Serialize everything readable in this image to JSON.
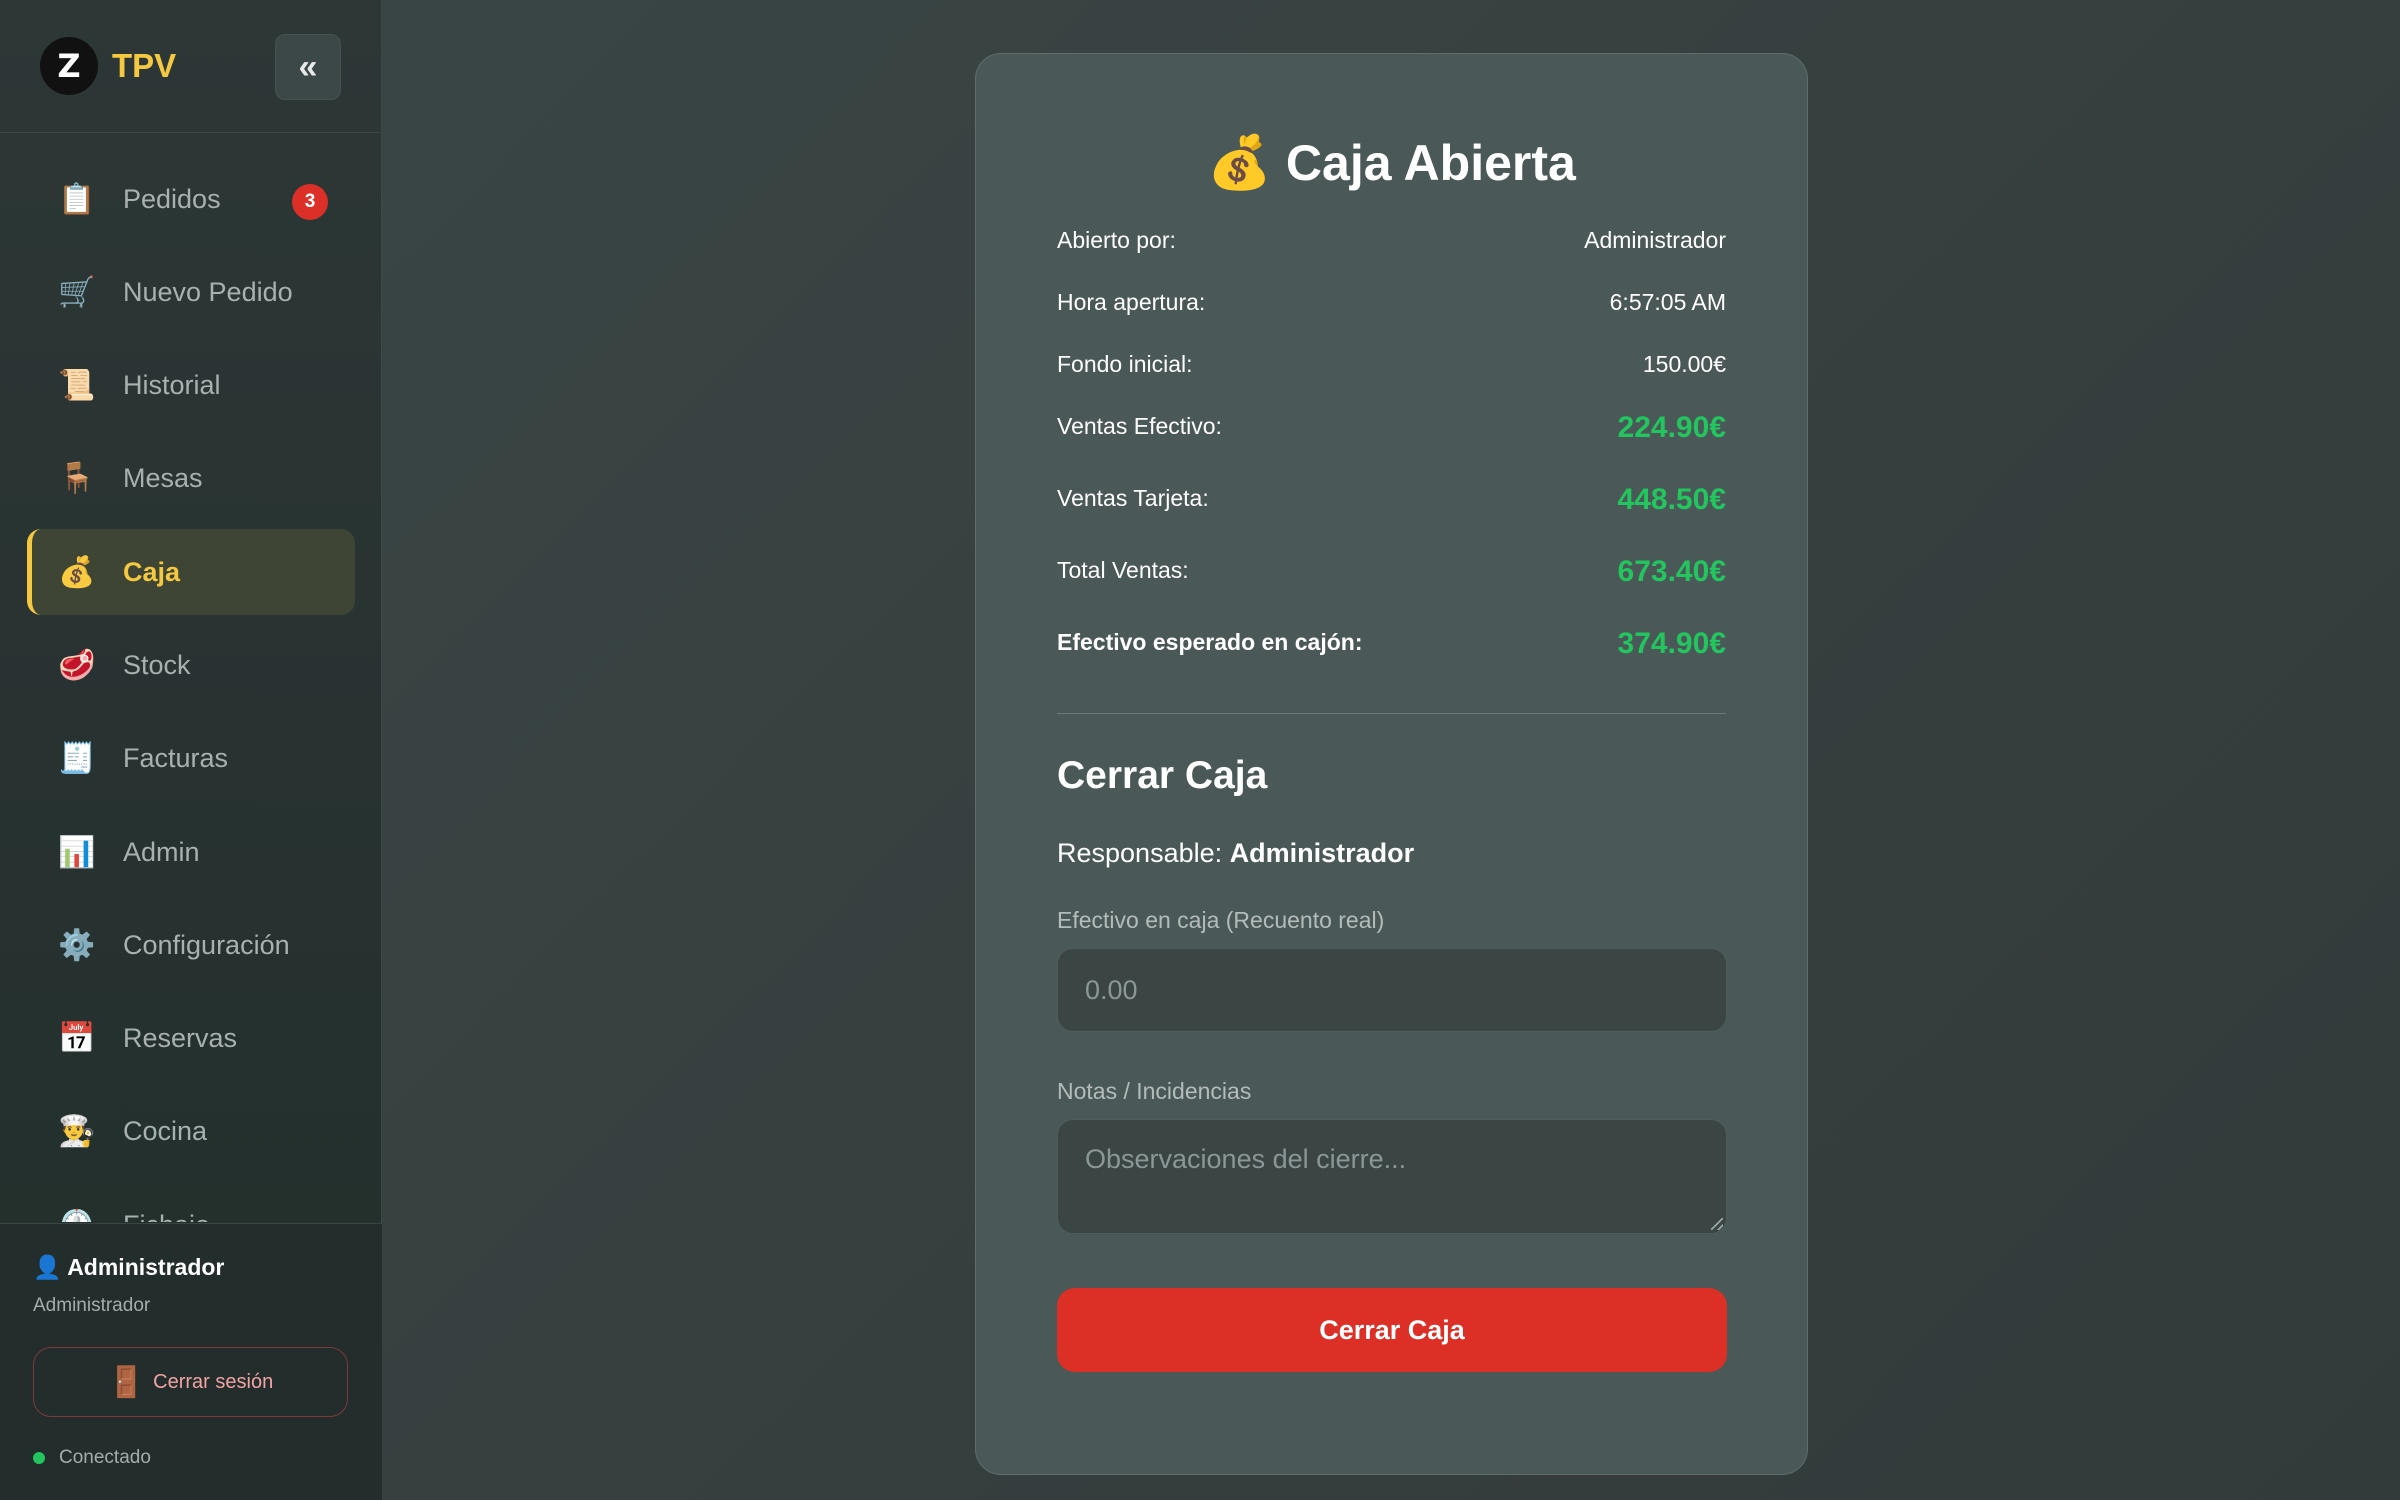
{
  "sidebar": {
    "logo_letter": "Z",
    "app_title": "TPV",
    "collapse_label": "«",
    "items": [
      {
        "icon": "📋",
        "label": "Pedidos",
        "badge": "3"
      },
      {
        "icon": "🛒",
        "label": "Nuevo Pedido"
      },
      {
        "icon": "📜",
        "label": "Historial"
      },
      {
        "icon": "🪑",
        "label": "Mesas"
      },
      {
        "icon": "💰",
        "label": "Caja",
        "active": true
      },
      {
        "icon": "🥩",
        "label": "Stock"
      },
      {
        "icon": "🧾",
        "label": "Facturas"
      },
      {
        "icon": "📊",
        "label": "Admin"
      },
      {
        "icon": "⚙️",
        "label": "Configuración"
      },
      {
        "icon": "📅",
        "label": "Reservas"
      },
      {
        "icon": "👨‍🍳",
        "label": "Cocina"
      },
      {
        "icon": "⏲️",
        "label": "Fichaje"
      }
    ],
    "user": {
      "icon": "👤",
      "name": "Administrador",
      "role": "Administrador"
    },
    "logout": {
      "icon": "🚪",
      "label": "Cerrar sesión"
    },
    "status": "Conectado"
  },
  "caja": {
    "title_icon": "💰",
    "title": "Caja Abierta",
    "rows": [
      {
        "label": "Abierto por:",
        "value": "Administrador",
        "kind": "plain"
      },
      {
        "label": "Hora apertura:",
        "value": "6:57:05 AM",
        "kind": "plain"
      },
      {
        "label": "Fondo inicial:",
        "value": "150.00€",
        "kind": "plain"
      },
      {
        "label": "Ventas Efectivo:",
        "value": "224.90€",
        "kind": "money"
      },
      {
        "label": "Ventas Tarjeta:",
        "value": "448.50€",
        "kind": "money"
      },
      {
        "label": "Total Ventas:",
        "value": "673.40€",
        "kind": "money"
      },
      {
        "label": "Efectivo esperado en cajón:",
        "value": "374.90€",
        "kind": "money bold"
      }
    ],
    "close_section": {
      "title": "Cerrar Caja",
      "responsable_label": "Responsable:",
      "responsable_name": "Administrador",
      "cash_label": "Efectivo en caja (Recuento real)",
      "cash_placeholder": "0.00",
      "notes_label": "Notas / Incidencias",
      "notes_placeholder": "Observaciones del cierre...",
      "button_label": "Cerrar Caja"
    }
  },
  "colors": {
    "accent": "#f5c842",
    "money": "#22c55e",
    "danger": "#dc3027",
    "badge": "#dc2f27"
  }
}
